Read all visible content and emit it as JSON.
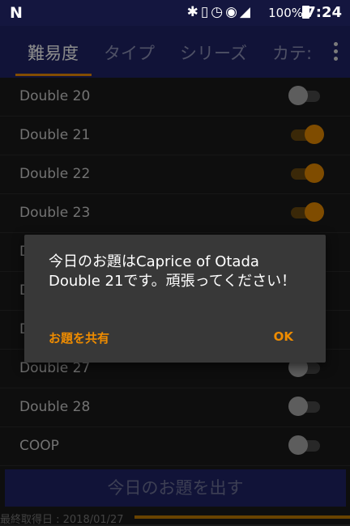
{
  "status_bar": {
    "logo": "N",
    "icons": [
      "bluetooth-icon",
      "vibrate-icon",
      "alarm-icon",
      "wifi-icon",
      "signal-icon"
    ],
    "battery": "100%",
    "time": "7:24"
  },
  "tabs": [
    {
      "label": "難易度"
    },
    {
      "label": "タイプ"
    },
    {
      "label": "シリーズ"
    },
    {
      "label": "カテ:"
    }
  ],
  "list": [
    {
      "label": "Double 20",
      "on": false
    },
    {
      "label": "Double 21",
      "on": true
    },
    {
      "label": "Double 22",
      "on": true
    },
    {
      "label": "Double 23",
      "on": true
    },
    {
      "label": "D",
      "on": true
    },
    {
      "label": "D",
      "on": false
    },
    {
      "label": "D",
      "on": false
    },
    {
      "label": "Double 27",
      "on": false
    },
    {
      "label": "Double 28",
      "on": false
    },
    {
      "label": "COOP",
      "on": false
    }
  ],
  "bottom_button": "今日のお題を出す",
  "footer": {
    "last_fetched": "最終取得日 : 2018/01/27"
  },
  "dialog": {
    "message": "今日のお題はCaprice of Otada Double 21です。頑張ってください！",
    "share": "お題を共有",
    "ok": "OK"
  },
  "colors": {
    "accent": "#ef8c00",
    "header": "#1f2466",
    "background": "#1b1b1b"
  }
}
